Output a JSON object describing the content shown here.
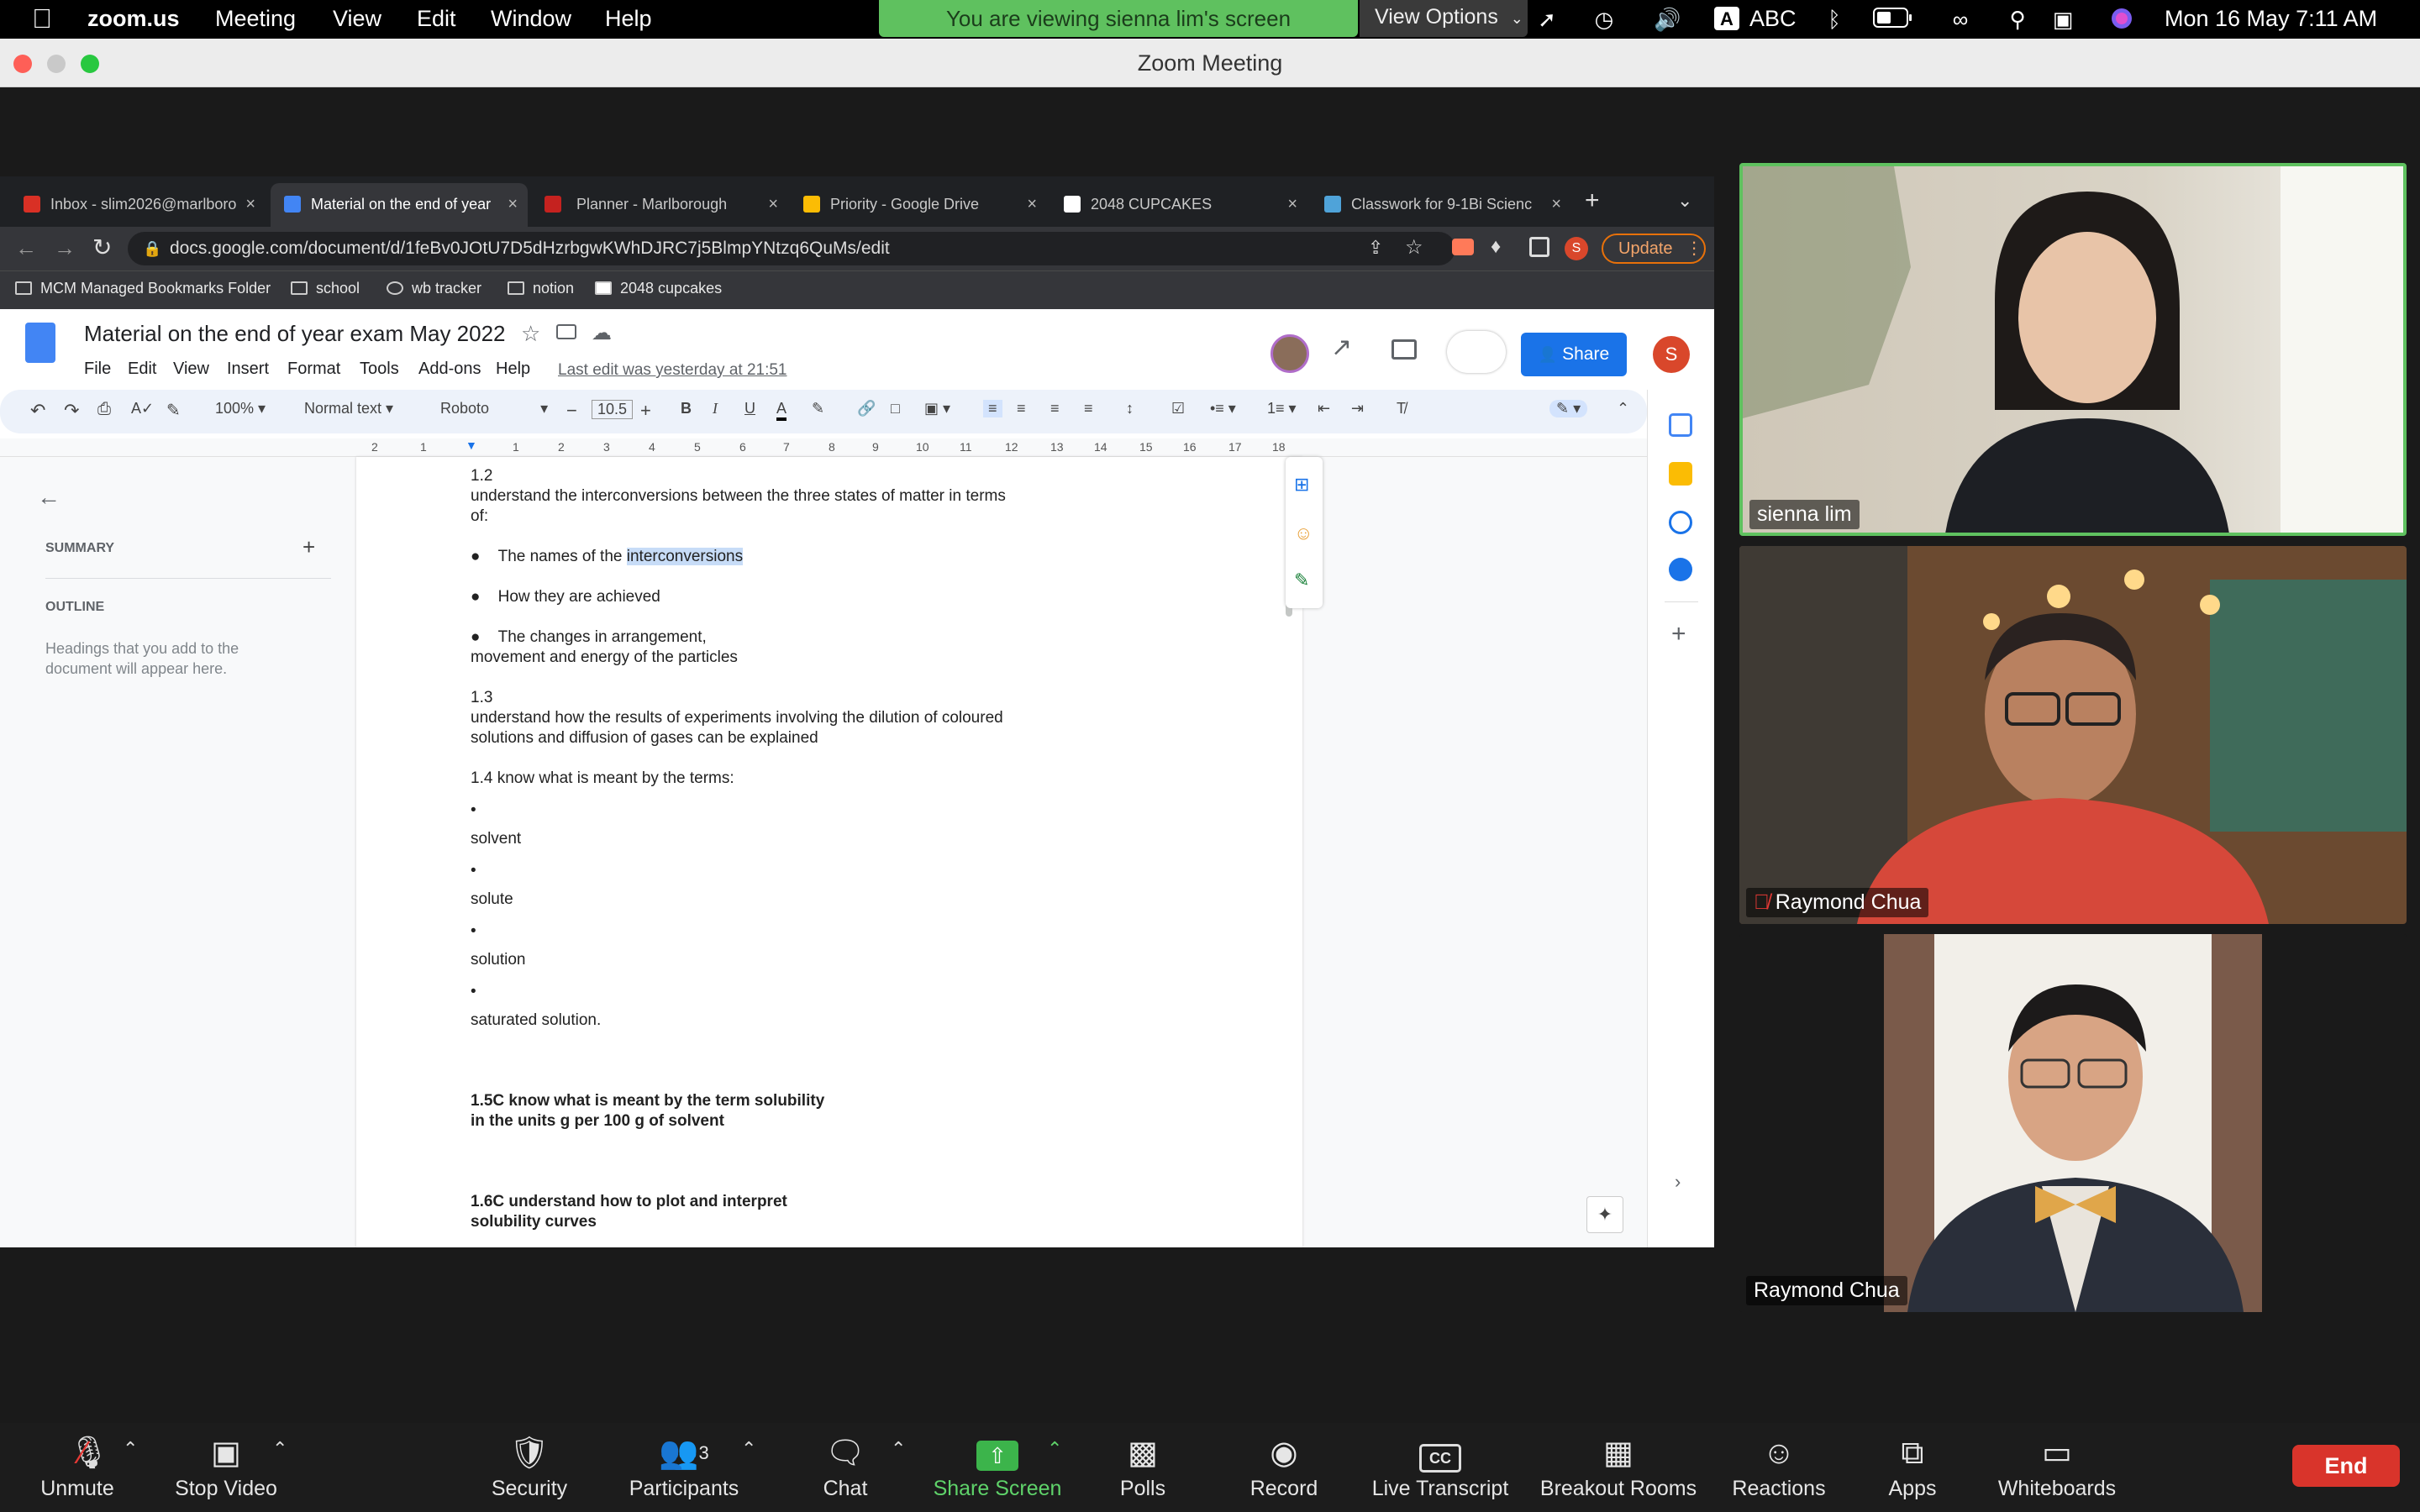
{
  "menubar": {
    "app_name": "zoom.us",
    "menus": [
      "Meeting",
      "View",
      "Edit",
      "Window",
      "Help"
    ],
    "share_banner": "You are viewing sienna lim's screen",
    "view_options": "View Options",
    "input_source": "ABC",
    "clock": "Mon 16 May  7:11 AM"
  },
  "zoom_window": {
    "title": "Zoom Meeting"
  },
  "browser": {
    "tabs": [
      {
        "label": "Inbox - slim2026@marlboro",
        "color": "#d93025"
      },
      {
        "label": "Material on the end of year",
        "color": "#4285f4"
      },
      {
        "label": "Planner - Marlborough",
        "color": "#c5221f"
      },
      {
        "label": "Priority - Google Drive",
        "color": "#fbbc04"
      },
      {
        "label": "2048 CUPCAKES",
        "color": "#ffffff"
      },
      {
        "label": "Classwork for 9-1Bi Scienc",
        "color": "#4fa3d9"
      }
    ],
    "url": "docs.google.com/document/d/1feBv0JOtU7D5dHzrbgwKWhDJRC7j5BlmpYNtzq6QuMs/edit",
    "update_label": "Update",
    "bookmarks": [
      "MCM Managed Bookmarks Folder",
      "school",
      "wb tracker",
      "notion",
      "2048 cupcakes"
    ]
  },
  "doc": {
    "title": "Material on the end of year exam May 2022",
    "menus": [
      "File",
      "Edit",
      "View",
      "Insert",
      "Format",
      "Tools",
      "Add-ons",
      "Help"
    ],
    "last_edit": "Last edit was yesterday at 21:51",
    "share_label": "Share",
    "avatar_letter": "S",
    "zoom": "100%",
    "style": "Normal text",
    "font": "Roboto",
    "font_size": "10.5",
    "ruler_marks": [
      "2",
      "1",
      "1",
      "2",
      "3",
      "4",
      "5",
      "6",
      "7",
      "8",
      "9",
      "10",
      "11",
      "12",
      "13",
      "14",
      "15",
      "16",
      "17",
      "18"
    ],
    "outline": {
      "summary": "SUMMARY",
      "outline": "OUTLINE",
      "hint_line1": "Headings that you add to the",
      "hint_line2": "document will appear here."
    },
    "lines": {
      "l1": "1.2",
      "l2": "understand the interconversions between the three states of matter in terms",
      "l3": "of:",
      "b1_pre": "The names of the ",
      "b1_hl": "interconversions",
      "b2": "How they are achieved",
      "b3": "The changes in arrangement,",
      "l4": "movement and energy of the particles",
      "l5": "1.3",
      "l6": "understand how the results of experiments involving the dilution of coloured",
      "l7": "solutions and diffusion of gases can be explained",
      "l8": "1.4 know what is meant by the terms:",
      "t1": "solvent",
      "t2": "solute",
      "t3": "solution",
      "t4": "saturated solution.",
      "l9": "1.5C know what is meant by the term solubility",
      "l10": "in the units g per 100 g of solvent",
      "l11": "1.6C understand how to plot and interpret",
      "l12": "solubility curves"
    }
  },
  "participants": [
    {
      "name": "sienna lim"
    },
    {
      "name": "Raymond Chua"
    },
    {
      "name": "Raymond Chua"
    }
  ],
  "controls": {
    "unmute": "Unmute",
    "stop_video": "Stop Video",
    "security": "Security",
    "participants": "Participants",
    "participants_count": "3",
    "chat": "Chat",
    "share_screen": "Share Screen",
    "polls": "Polls",
    "record": "Record",
    "live_transcript": "Live Transcript",
    "breakout_rooms": "Breakout Rooms",
    "reactions": "Reactions",
    "apps": "Apps",
    "whiteboards": "Whiteboards",
    "end": "End"
  },
  "colors": {
    "share_green": "#5fc15f",
    "end_red": "#d9342b",
    "docs_blue": "#1a73e8",
    "active_speaker": "#5fc15f"
  }
}
